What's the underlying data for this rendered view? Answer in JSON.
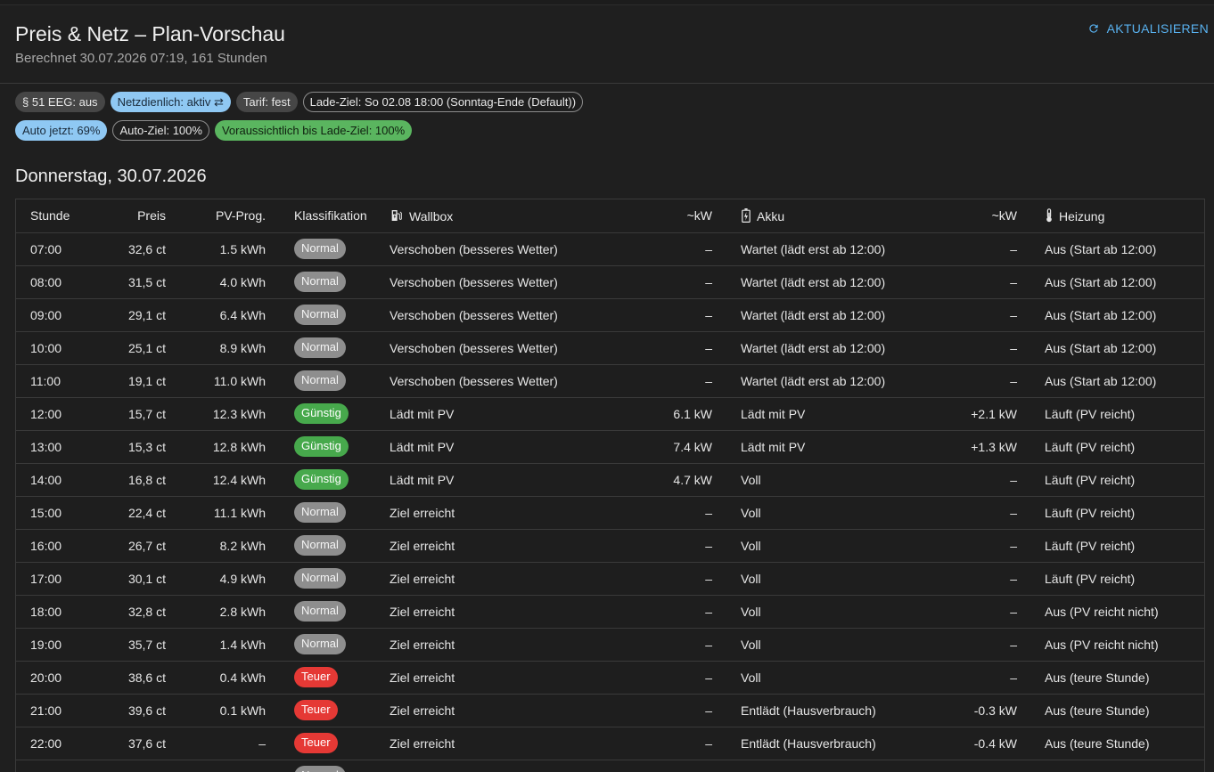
{
  "header": {
    "title": "Preis & Netz – Plan-Vorschau",
    "subtitle": "Berechnet 30.07.2026 07:19, 161 Stunden",
    "refresh_label": "AKTUALISIEREN"
  },
  "chips": {
    "row1": [
      "§ 51 EEG: aus",
      "Netzdienlich: aktiv ⇄",
      "Tarif: fest",
      "Lade-Ziel: So 02.08 18:00 (Sonntag-Ende (Default))"
    ],
    "row2": [
      "Auto jetzt: 69%",
      "Auto-Ziel: 100%",
      "Voraussichtlich bis Lade-Ziel: 100%"
    ]
  },
  "day_title": "Donnerstag, 30.07.2026",
  "table": {
    "headers": {
      "stunde": "Stunde",
      "preis": "Preis",
      "pv": "PV-Prog.",
      "klass": "Klassifikation",
      "wallbox": "Wallbox",
      "wb_kw": "~kW",
      "akku": "Akku",
      "akku_kw": "~kW",
      "heizung": "Heizung"
    },
    "rows": [
      {
        "stunde": "07:00",
        "preis": "32,6 ct",
        "pv": "1.5 kWh",
        "klass": "Normal",
        "wallbox": "Verschoben (besseres Wetter)",
        "wb_kw": "–",
        "akku": "Wartet (lädt erst ab 12:00)",
        "akku_kw": "–",
        "heizung": "Aus (Start ab 12:00)"
      },
      {
        "stunde": "08:00",
        "preis": "31,5 ct",
        "pv": "4.0 kWh",
        "klass": "Normal",
        "wallbox": "Verschoben (besseres Wetter)",
        "wb_kw": "–",
        "akku": "Wartet (lädt erst ab 12:00)",
        "akku_kw": "–",
        "heizung": "Aus (Start ab 12:00)"
      },
      {
        "stunde": "09:00",
        "preis": "29,1 ct",
        "pv": "6.4 kWh",
        "klass": "Normal",
        "wallbox": "Verschoben (besseres Wetter)",
        "wb_kw": "–",
        "akku": "Wartet (lädt erst ab 12:00)",
        "akku_kw": "–",
        "heizung": "Aus (Start ab 12:00)"
      },
      {
        "stunde": "10:00",
        "preis": "25,1 ct",
        "pv": "8.9 kWh",
        "klass": "Normal",
        "wallbox": "Verschoben (besseres Wetter)",
        "wb_kw": "–",
        "akku": "Wartet (lädt erst ab 12:00)",
        "akku_kw": "–",
        "heizung": "Aus (Start ab 12:00)"
      },
      {
        "stunde": "11:00",
        "preis": "19,1 ct",
        "pv": "11.0 kWh",
        "klass": "Normal",
        "wallbox": "Verschoben (besseres Wetter)",
        "wb_kw": "–",
        "akku": "Wartet (lädt erst ab 12:00)",
        "akku_kw": "–",
        "heizung": "Aus (Start ab 12:00)"
      },
      {
        "stunde": "12:00",
        "preis": "15,7 ct",
        "pv": "12.3 kWh",
        "klass": "Günstig",
        "wallbox": "Lädt mit PV",
        "wb_kw": "6.1 kW",
        "akku": "Lädt mit PV",
        "akku_kw": "+2.1 kW",
        "heizung": "Läuft (PV reicht)"
      },
      {
        "stunde": "13:00",
        "preis": "15,3 ct",
        "pv": "12.8 kWh",
        "klass": "Günstig",
        "wallbox": "Lädt mit PV",
        "wb_kw": "7.4 kW",
        "akku": "Lädt mit PV",
        "akku_kw": "+1.3 kW",
        "heizung": "Läuft (PV reicht)"
      },
      {
        "stunde": "14:00",
        "preis": "16,8 ct",
        "pv": "12.4 kWh",
        "klass": "Günstig",
        "wallbox": "Lädt mit PV",
        "wb_kw": "4.7 kW",
        "akku": "Voll",
        "akku_kw": "–",
        "heizung": "Läuft (PV reicht)"
      },
      {
        "stunde": "15:00",
        "preis": "22,4 ct",
        "pv": "11.1 kWh",
        "klass": "Normal",
        "wallbox": "Ziel erreicht",
        "wb_kw": "–",
        "akku": "Voll",
        "akku_kw": "–",
        "heizung": "Läuft (PV reicht)"
      },
      {
        "stunde": "16:00",
        "preis": "26,7 ct",
        "pv": "8.2 kWh",
        "klass": "Normal",
        "wallbox": "Ziel erreicht",
        "wb_kw": "–",
        "akku": "Voll",
        "akku_kw": "–",
        "heizung": "Läuft (PV reicht)"
      },
      {
        "stunde": "17:00",
        "preis": "30,1 ct",
        "pv": "4.9 kWh",
        "klass": "Normal",
        "wallbox": "Ziel erreicht",
        "wb_kw": "–",
        "akku": "Voll",
        "akku_kw": "–",
        "heizung": "Läuft (PV reicht)"
      },
      {
        "stunde": "18:00",
        "preis": "32,8 ct",
        "pv": "2.8 kWh",
        "klass": "Normal",
        "wallbox": "Ziel erreicht",
        "wb_kw": "–",
        "akku": "Voll",
        "akku_kw": "–",
        "heizung": "Aus (PV reicht nicht)"
      },
      {
        "stunde": "19:00",
        "preis": "35,7 ct",
        "pv": "1.4 kWh",
        "klass": "Normal",
        "wallbox": "Ziel erreicht",
        "wb_kw": "–",
        "akku": "Voll",
        "akku_kw": "–",
        "heizung": "Aus (PV reicht nicht)"
      },
      {
        "stunde": "20:00",
        "preis": "38,6 ct",
        "pv": "0.4 kWh",
        "klass": "Teuer",
        "wallbox": "Ziel erreicht",
        "wb_kw": "–",
        "akku": "Voll",
        "akku_kw": "–",
        "heizung": "Aus (teure Stunde)"
      },
      {
        "stunde": "21:00",
        "preis": "39,6 ct",
        "pv": "0.1 kWh",
        "klass": "Teuer",
        "wallbox": "Ziel erreicht",
        "wb_kw": "–",
        "akku": "Entlädt (Hausverbrauch)",
        "akku_kw": "-0.3 kW",
        "heizung": "Aus (teure Stunde)"
      },
      {
        "stunde": "22:00",
        "preis": "37,6 ct",
        "pv": "–",
        "klass": "Teuer",
        "wallbox": "Ziel erreicht",
        "wb_kw": "–",
        "akku": "Entlädt (Hausverbrauch)",
        "akku_kw": "-0.4 kW",
        "heizung": "Aus (teure Stunde)"
      },
      {
        "stunde": "",
        "preis": "",
        "pv": "",
        "klass": "Normal",
        "wallbox": "",
        "wb_kw": "",
        "akku": "",
        "akku_kw": "",
        "heizung": ""
      }
    ]
  },
  "colors": {
    "accent": "#59b2f0",
    "normal": "#8e8e8e",
    "guenstig": "#47a94c",
    "teuer": "#e53935"
  }
}
